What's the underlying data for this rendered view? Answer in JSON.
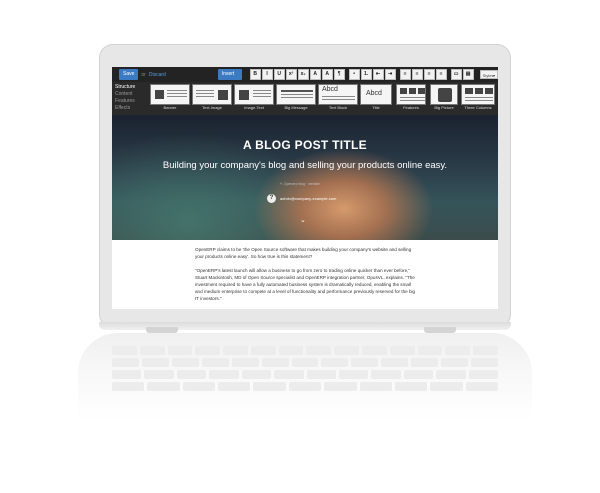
{
  "editor": {
    "save_label": "Save",
    "or_label": "or",
    "discard_label": "Discard",
    "insert_blocks_label": "Insert Blocks",
    "format_tools": [
      "B",
      "I",
      "U",
      "x²",
      "x₂",
      "A",
      "A",
      "¶"
    ],
    "list_tools": [
      "•",
      "1.",
      "⇤",
      "⇥"
    ],
    "align_tools": [
      "≡",
      "≡",
      "≡",
      "≡"
    ],
    "media_tools": [
      "▭",
      "▤"
    ],
    "styles_label": "Styles"
  },
  "snippets": {
    "categories": [
      {
        "label": "Structure",
        "active": true
      },
      {
        "label": "Content",
        "active": false
      },
      {
        "label": "Features",
        "active": false
      },
      {
        "label": "Effects",
        "active": false
      }
    ],
    "items": [
      {
        "label": "Banner"
      },
      {
        "label": "Text-Image"
      },
      {
        "label": "Image-Text"
      },
      {
        "label": "Big Message"
      },
      {
        "label": "Text Block"
      },
      {
        "label": "Title"
      },
      {
        "label": "Features"
      },
      {
        "label": "Big Picture"
      },
      {
        "label": "Three Columns"
      }
    ],
    "text_block_thumb": "Abcd",
    "title_thumb": "Abcd"
  },
  "hero": {
    "title": "A BLOG POST TITLE",
    "subtitle": "Building your company's blog and selling your products online easy.",
    "meta": "✎ Openerp blog · website",
    "author_email": "admin@company-example.com"
  },
  "content": {
    "paragraph1": "OpenERP claims to be 'the Open Source software that makes building your company's website and selling your products online easy'. So how true is this statement?",
    "paragraph2": "\"OpenERP's latest launch will allow a business to go from zero to trading online quicker than ever before,\" Stuart Mackintosh, MD of Open Source specialist and OpenERP integration partner, OpusVL, explains. \"The investment required to have a fully automated business system is dramatically reduced, enabling the small and medium enterprise to compete at a level of functionality and performance previously reserved for the big IT investors.\""
  }
}
